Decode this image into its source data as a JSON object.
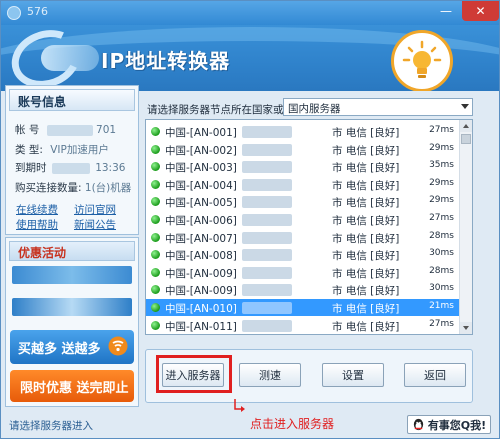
{
  "window": {
    "title": "576",
    "minimize_glyph": "—",
    "close_glyph": "✕"
  },
  "header": {
    "app_name": "IP地址转换器",
    "logo_icon": "globe-ring-logo",
    "badge_icon": "lightbulb-icon"
  },
  "account": {
    "heading": "账号信息",
    "username_label": "帐  号",
    "username_suffix": "701",
    "type_label": "类  型:",
    "type_value": "VIP加速用户",
    "expiry_label": "到期时",
    "expiry_suffix": "13:36",
    "purchase_label": "购买连接数量:",
    "purchase_value": "1(台)机器",
    "links": [
      "在线续费",
      "访问官网",
      "使用帮助",
      "新闻公告"
    ]
  },
  "promo": {
    "heading": "优惠活动",
    "buy_more": "买越多 送越多",
    "limited": "限时优惠 送完即止",
    "colors": {
      "buy_more": "#1f74c5",
      "limited": "#e75b0a"
    }
  },
  "region": {
    "label": "请选择服务器节点所在国家或地区:",
    "selected": "国内服务器"
  },
  "servers": [
    {
      "name": "中国-[AN-001]",
      "isp": "市 电信 [良好]",
      "latency": "27ms",
      "selected": false
    },
    {
      "name": "中国-[AN-002]",
      "isp": "市 电信 [良好]",
      "latency": "29ms",
      "selected": false
    },
    {
      "name": "中国-[AN-003]",
      "isp": "市 电信 [良好]",
      "latency": "35ms",
      "selected": false
    },
    {
      "name": "中国-[AN-004]",
      "isp": "市 电信 [良好]",
      "latency": "29ms",
      "selected": false
    },
    {
      "name": "中国-[AN-005]",
      "isp": "市 电信 [良好]",
      "latency": "29ms",
      "selected": false
    },
    {
      "name": "中国-[AN-006]",
      "isp": "市 电信 [良好]",
      "latency": "27ms",
      "selected": false
    },
    {
      "name": "中国-[AN-007]",
      "isp": "市 电信 [良好]",
      "latency": "28ms",
      "selected": false
    },
    {
      "name": "中国-[AN-008]",
      "isp": "市 电信 [良好]",
      "latency": "30ms",
      "selected": false
    },
    {
      "name": "中国-[AN-009]",
      "isp": "市 电信 [良好]",
      "latency": "28ms",
      "selected": false
    },
    {
      "name": "中国-[AN-009]",
      "isp": "市 电信 [良好]",
      "latency": "30ms",
      "selected": false
    },
    {
      "name": "中国-[AN-010]",
      "isp": "市 电信 [良好]",
      "latency": "21ms",
      "selected": true
    },
    {
      "name": "中国-[AN-011]",
      "isp": "市 电信 [良好]",
      "latency": "27ms",
      "selected": false
    }
  ],
  "buttons": {
    "enter": "进入服务器",
    "speed": "测速",
    "settings": "设置",
    "back": "返回"
  },
  "hint": "点击进入服务器",
  "status": "请选择服务器进入",
  "qq_button": "有事您Q我!"
}
